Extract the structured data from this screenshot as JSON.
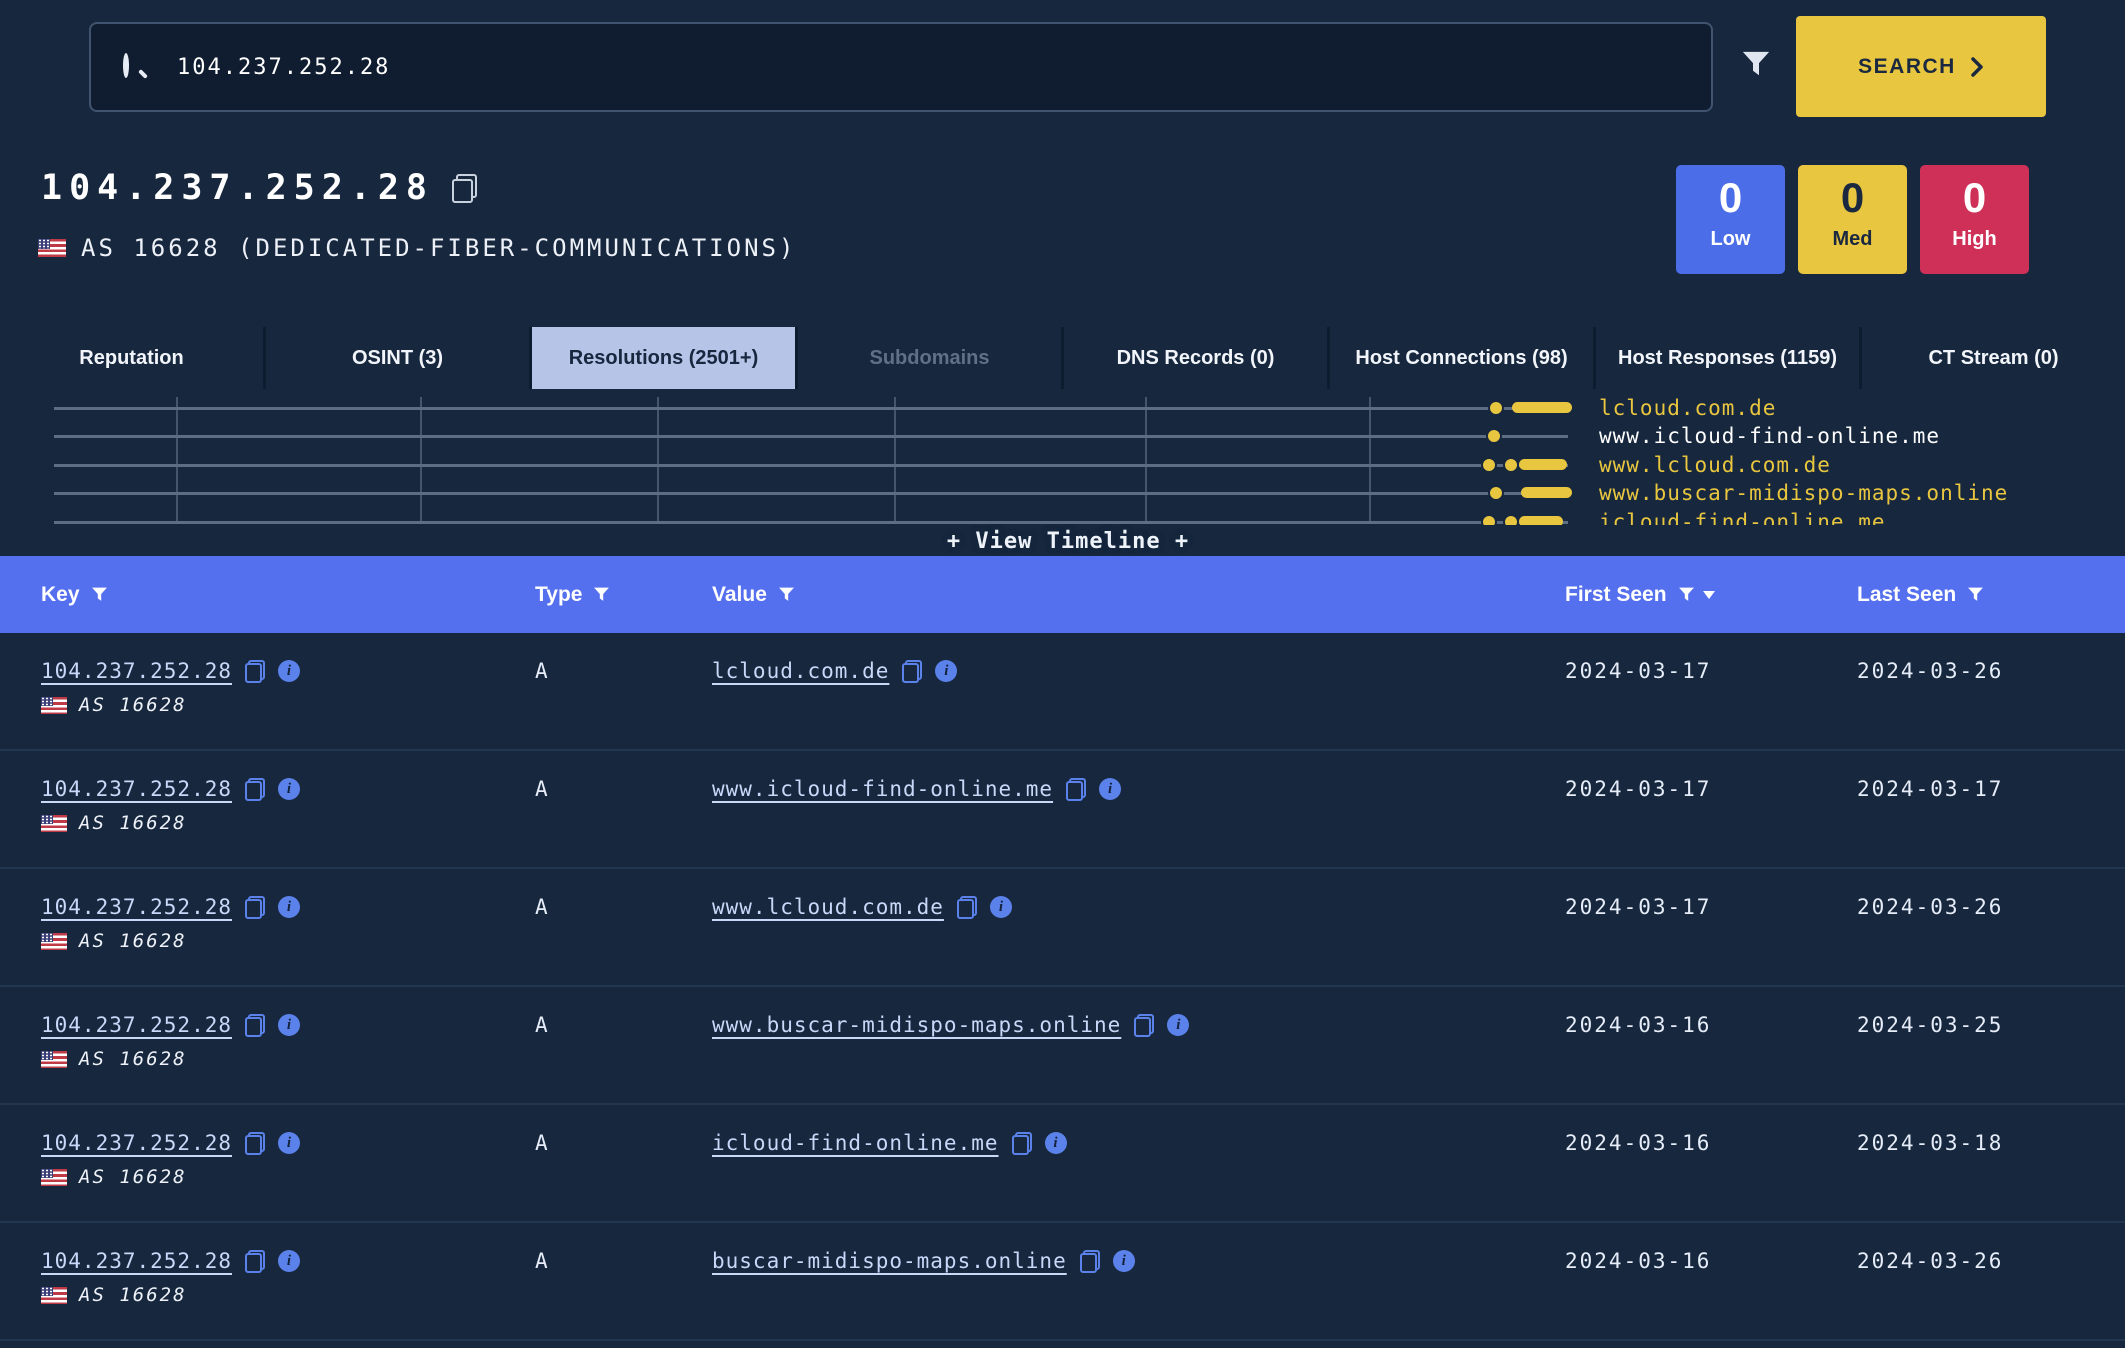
{
  "search": {
    "query": "104.237.252.28",
    "button_label": "SEARCH"
  },
  "header": {
    "title": "104.237.252.28",
    "asn_line": "AS 16628 (DEDICATED-FIBER-COMMUNICATIONS)",
    "badges": [
      {
        "count": "0",
        "label": "Low",
        "bg": "#4b6ee8",
        "fg": "#ffffff"
      },
      {
        "count": "0",
        "label": "Med",
        "bg": "#e9c63f",
        "fg": "#1a2940"
      },
      {
        "count": "0",
        "label": "High",
        "bg": "#ce3058",
        "fg": "#ffffff"
      }
    ]
  },
  "tabs": [
    {
      "label": "Reputation"
    },
    {
      "label": "OSINT (3)"
    },
    {
      "label": "Resolutions (2501+)",
      "active": true
    },
    {
      "label": "Subdomains",
      "disabled": true
    },
    {
      "label": "DNS Records (0)"
    },
    {
      "label": "Host Connections (98)"
    },
    {
      "label": "Host Responses (1159)"
    },
    {
      "label": "CT Stream (0)"
    }
  ],
  "timeline": {
    "view_label": "+ View Timeline +",
    "entries": [
      {
        "label": "lcloud.com.de",
        "color": "#e9c63f"
      },
      {
        "label": "www.icloud-find-online.me",
        "color": "#ffffff"
      },
      {
        "label": "www.lcloud.com.de",
        "color": "#e9c63f"
      },
      {
        "label": "www.buscar-midispo-maps.online",
        "color": "#e9c63f"
      },
      {
        "label": "icloud-find-online.me",
        "color": "#e9c63f"
      }
    ]
  },
  "table": {
    "columns": {
      "key": "Key",
      "type": "Type",
      "value": "Value",
      "first_seen": "First Seen",
      "last_seen": "Last Seen"
    },
    "rows": [
      {
        "key": "104.237.252.28",
        "asn": "AS 16628",
        "type": "A",
        "value": "lcloud.com.de",
        "first_seen": "2024-03-17",
        "last_seen": "2024-03-26"
      },
      {
        "key": "104.237.252.28",
        "asn": "AS 16628",
        "type": "A",
        "value": "www.icloud-find-online.me",
        "first_seen": "2024-03-17",
        "last_seen": "2024-03-17"
      },
      {
        "key": "104.237.252.28",
        "asn": "AS 16628",
        "type": "A",
        "value": "www.lcloud.com.de",
        "first_seen": "2024-03-17",
        "last_seen": "2024-03-26"
      },
      {
        "key": "104.237.252.28",
        "asn": "AS 16628",
        "type": "A",
        "value": "www.buscar-midispo-maps.online",
        "first_seen": "2024-03-16",
        "last_seen": "2024-03-25"
      },
      {
        "key": "104.237.252.28",
        "asn": "AS 16628",
        "type": "A",
        "value": "icloud-find-online.me",
        "first_seen": "2024-03-16",
        "last_seen": "2024-03-18"
      },
      {
        "key": "104.237.252.28",
        "asn": "AS 16628",
        "type": "A",
        "value": "buscar-midispo-maps.online",
        "first_seen": "2024-03-16",
        "last_seen": "2024-03-26"
      }
    ]
  }
}
